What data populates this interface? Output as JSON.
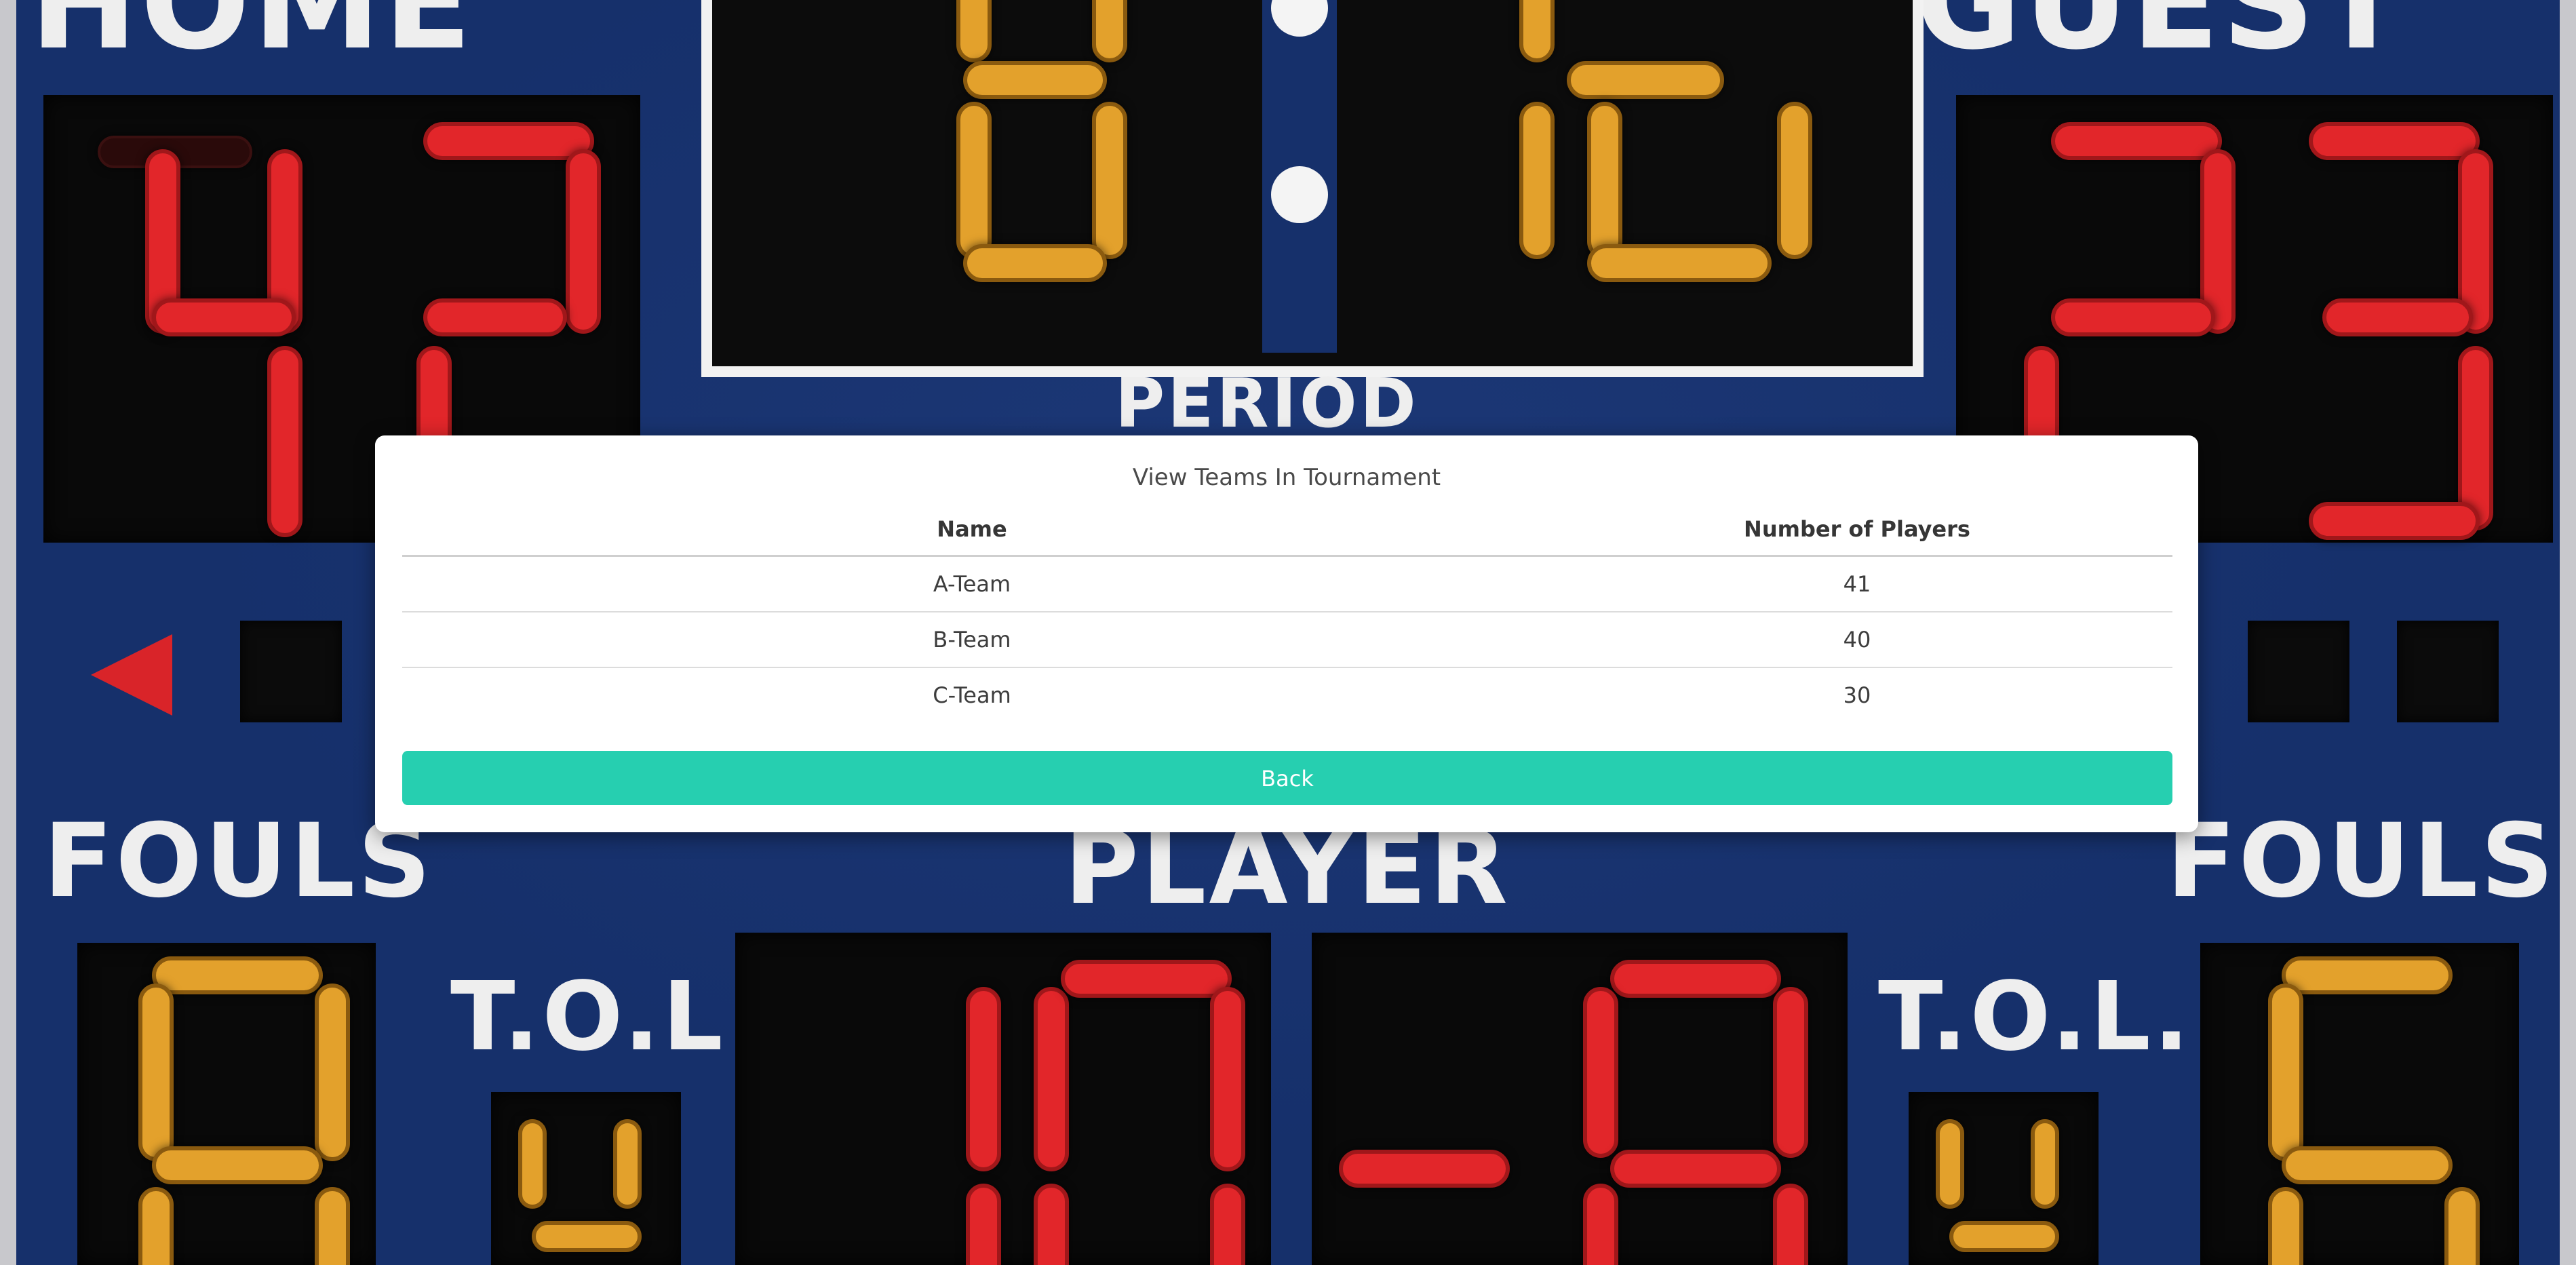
{
  "scoreboard": {
    "home_label": "HOME",
    "guest_label": "GUEST",
    "period_label": "PERIOD",
    "player_label": "PLAYER",
    "fouls_left_label": "FOULS",
    "fouls_right_label": "FOULS",
    "tol_left_label": "T.O.L.",
    "tol_right_label": "T.O.L.",
    "possession_icon": "arrow-left-icon"
  },
  "modal": {
    "title": "View Teams In Tournament",
    "columns": {
      "name": "Name",
      "players": "Number of Players"
    },
    "rows": [
      {
        "name": "A-Team",
        "players": "41"
      },
      {
        "name": "B-Team",
        "players": "40"
      },
      {
        "name": "C-Team",
        "players": "30"
      }
    ],
    "back_label": "Back"
  },
  "colors": {
    "board": "#16306b",
    "led_red": "#e2262a",
    "led_amber": "#e3a12c",
    "button_accent": "#26cfb0"
  }
}
